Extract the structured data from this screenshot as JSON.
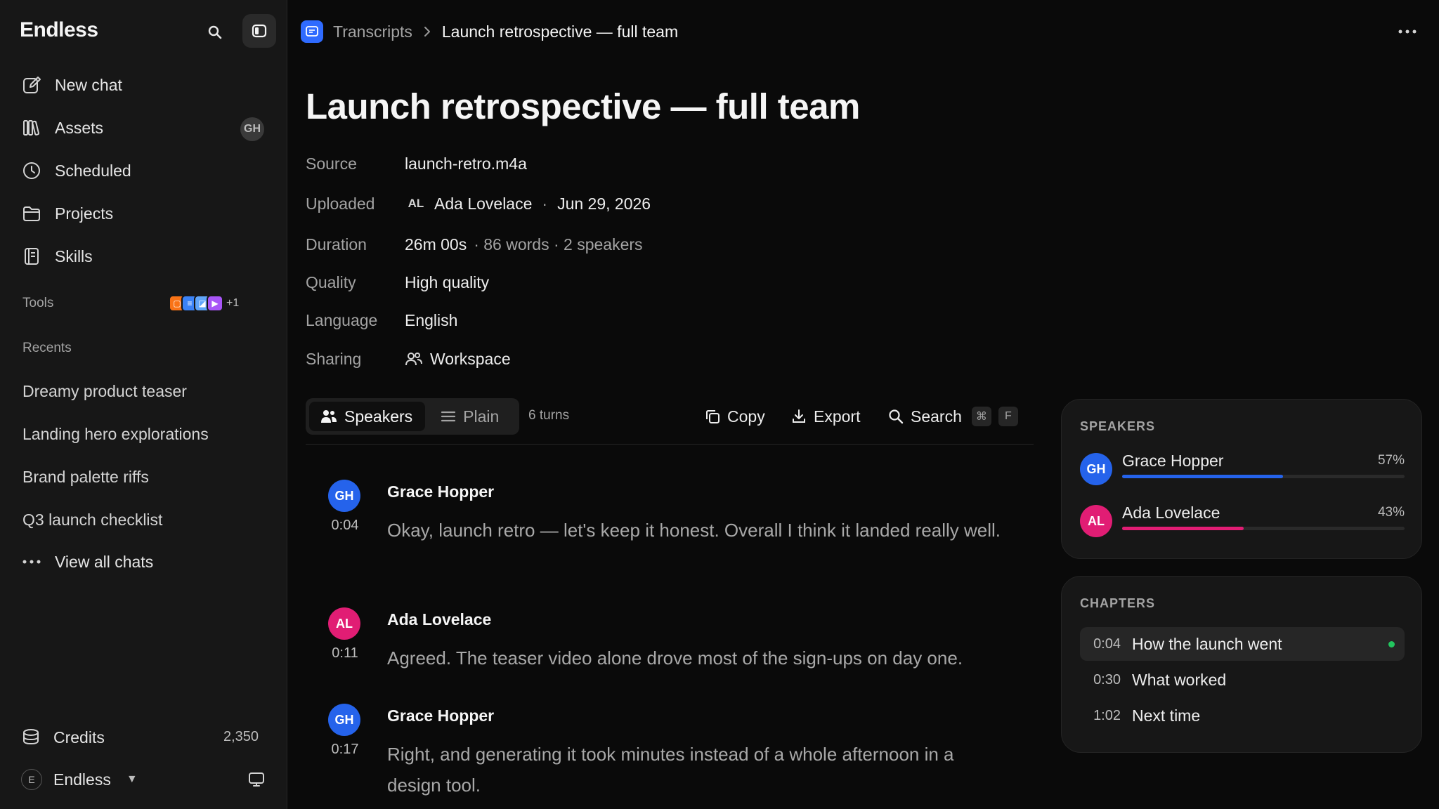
{
  "sidebar": {
    "brand": "Endless",
    "nav": [
      {
        "label": "New chat",
        "icon": "new-chat-icon"
      },
      {
        "label": "Assets",
        "icon": "assets-icon"
      },
      {
        "label": "Scheduled",
        "icon": "clock-icon"
      },
      {
        "label": "Projects",
        "icon": "folder-icon"
      },
      {
        "label": "Skills",
        "icon": "skills-icon"
      }
    ],
    "assets_badge": "GH",
    "tools_label": "Tools",
    "tools_more": "+1",
    "tools_colors": [
      "#f97316",
      "#3b82f6",
      "#60a5fa",
      "#a855f7",
      "#c026d3"
    ],
    "recents_label": "Recents",
    "recents": [
      "Dreamy product teaser",
      "Landing hero explorations",
      "Brand palette riffs",
      "Q3 launch checklist"
    ],
    "view_all": "View all chats",
    "credits_label": "Credits",
    "credits_value": "2,350",
    "workspace_initial": "E",
    "workspace_name": "Endless"
  },
  "breadcrumb": {
    "section": "Transcripts",
    "current": "Launch retrospective — full team"
  },
  "doc": {
    "title": "Launch retrospective — full team",
    "meta": {
      "source_label": "Source",
      "source": "launch-retro.m4a",
      "uploaded_label": "Uploaded",
      "uploader_initials": "AL",
      "uploader": "Ada Lovelace",
      "date_sep": "·",
      "date": "Jun 29, 2026",
      "duration_label": "Duration",
      "duration": "26m 00s",
      "duration_extra": "· 86 words · 2 speakers",
      "quality_label": "Quality",
      "quality": "High quality",
      "language_label": "Language",
      "language": "English",
      "sharing_label": "Sharing",
      "sharing": "Workspace"
    }
  },
  "toolbar": {
    "view_speakers": "Speakers",
    "view_plain": "Plain",
    "turns": "6 turns",
    "copy": "Copy",
    "export": "Export",
    "search": "Search",
    "kbd_cmd": "⌘",
    "kbd_key": "F"
  },
  "turns": [
    {
      "initials": "GH",
      "speaker": "Grace Hopper",
      "time": "0:04",
      "text": "Okay, launch retro — let's keep it honest. Overall I think it landed really well."
    },
    {
      "initials": "AL",
      "speaker": "Ada Lovelace",
      "time": "0:11",
      "text": "Agreed. The teaser video alone drove most of the sign-ups on day one."
    },
    {
      "initials": "GH",
      "speaker": "Grace Hopper",
      "time": "0:17",
      "text": "Right, and generating it took minutes instead of a whole afternoon in a design tool."
    }
  ],
  "speakers_panel": {
    "title": "SPEAKERS",
    "items": [
      {
        "initials": "GH",
        "name": "Grace Hopper",
        "pct_label": "57%",
        "share": 0.57,
        "color": "#2563eb"
      },
      {
        "initials": "AL",
        "name": "Ada Lovelace",
        "pct_label": "43%",
        "share": 0.43,
        "color": "#e11d74"
      }
    ]
  },
  "chapters_panel": {
    "title": "CHAPTERS",
    "items": [
      {
        "time": "0:04",
        "label": "How the launch went",
        "active": true
      },
      {
        "time": "0:30",
        "label": "What worked",
        "active": false
      },
      {
        "time": "1:02",
        "label": "Next time",
        "active": false
      }
    ]
  }
}
